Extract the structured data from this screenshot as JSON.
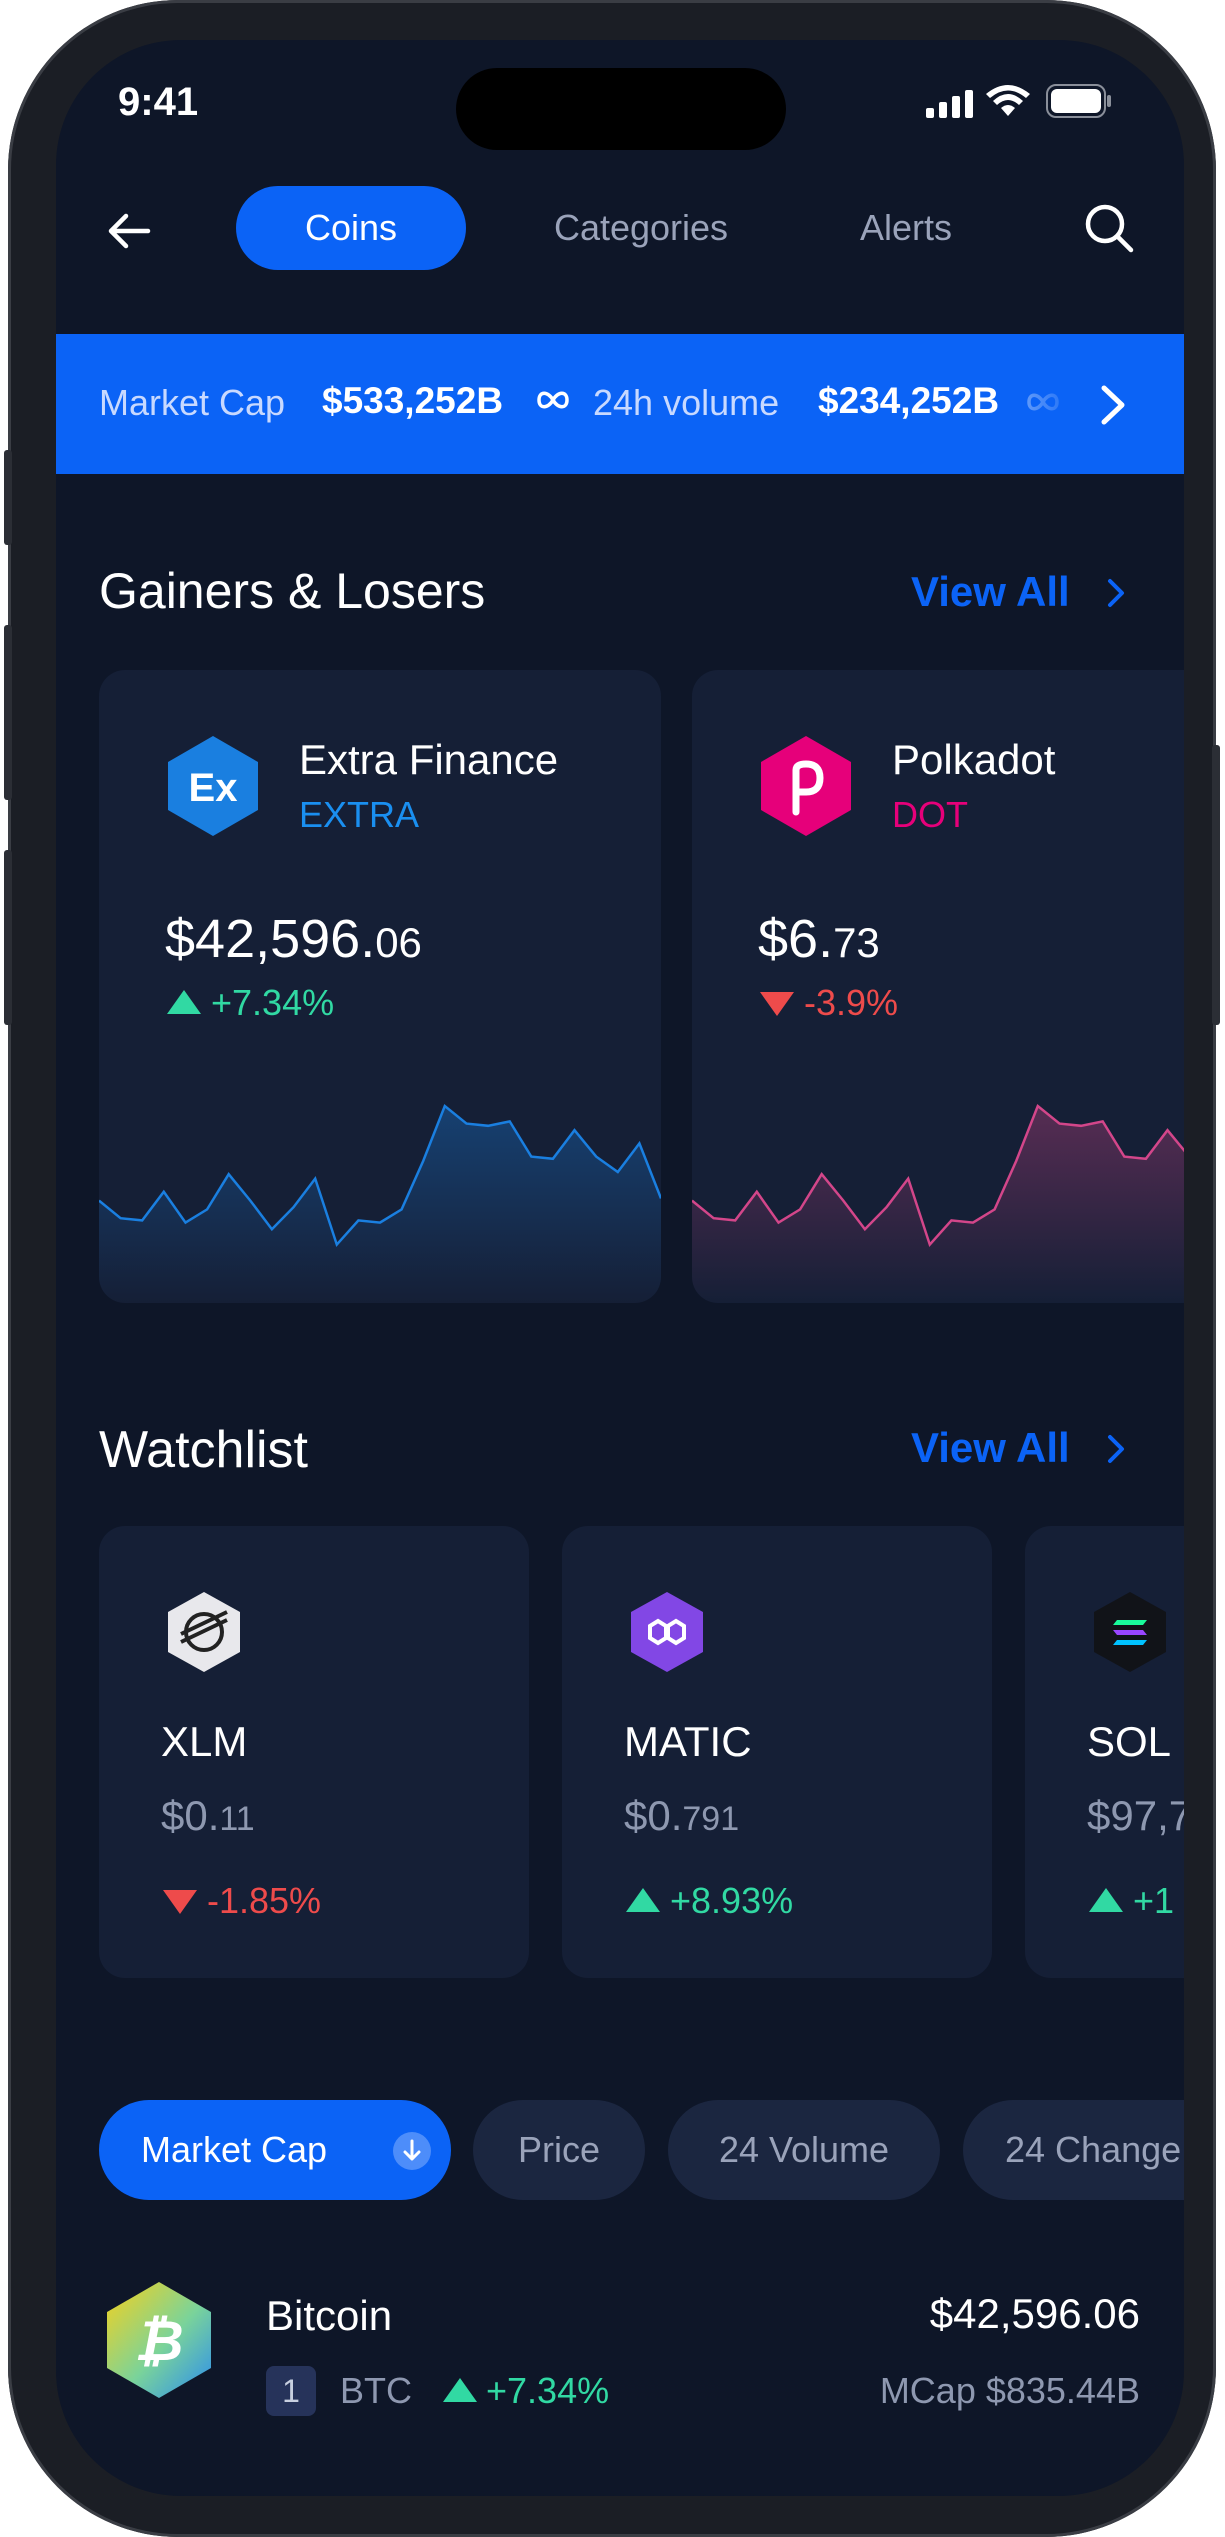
{
  "status": {
    "time": "9:41"
  },
  "nav": {
    "tabs": [
      "Coins",
      "Categories",
      "Alerts"
    ]
  },
  "market": {
    "cap_label": "Market Cap",
    "cap_value": "$533,252B",
    "vol_label": "24h volume",
    "vol_value": "$234,252B"
  },
  "gainers": {
    "title": "Gainers & Losers",
    "view_all": "View All",
    "cards": [
      {
        "name": "Extra Finance",
        "symbol": "EXTRA",
        "price_main": "$42,596.",
        "price_dec": "06",
        "change": "+7.34%",
        "dir": "up",
        "logo_text": "Ex",
        "logo_color": "#1a7fe0",
        "chart_color": "#1a7fe0",
        "spark": [
          42,
          34,
          33,
          46,
          32,
          38,
          54,
          42,
          29,
          39,
          52,
          22,
          33,
          32,
          38,
          60,
          85,
          77,
          76,
          78,
          62,
          61,
          74,
          62,
          55,
          68,
          43
        ]
      },
      {
        "name": "Polkadot",
        "symbol": "DOT",
        "price_main": "$6.",
        "price_dec": "73",
        "change": "-3.9%",
        "dir": "down",
        "logo_text": "P",
        "logo_color": "#e6007a",
        "chart_color": "#d3468a",
        "spark": [
          42,
          34,
          33,
          46,
          32,
          38,
          54,
          42,
          29,
          39,
          52,
          22,
          33,
          32,
          38,
          60,
          85,
          77,
          76,
          78,
          62,
          61,
          74,
          62,
          55,
          68,
          43
        ]
      }
    ]
  },
  "watchlist": {
    "title": "Watchlist",
    "view_all": "View All",
    "items": [
      {
        "symbol": "XLM",
        "price_main": "$0.",
        "price_dec": "11",
        "change": "-1.85%",
        "dir": "down",
        "logo_color": "#e8e8ec",
        "icon": "stellar-icon"
      },
      {
        "symbol": "MATIC",
        "price_main": "$0.",
        "price_dec": "791",
        "change": "+8.93%",
        "dir": "up",
        "logo_color": "#8247e5",
        "icon": "polygon-icon"
      },
      {
        "symbol": "SOL",
        "price_main": "$97,7",
        "price_dec": "",
        "change": "+1",
        "dir": "up",
        "logo_color": "#111318",
        "icon": "solana-icon"
      }
    ]
  },
  "sort": {
    "options": [
      "Market Cap",
      "Price",
      "24 Volume",
      "24 Change"
    ],
    "active": "Market Cap"
  },
  "coins": [
    {
      "name": "Bitcoin",
      "rank": "1",
      "symbol": "BTC",
      "change": "+7.34%",
      "price": "$42,596.06",
      "mcap": "MCap $835.44B"
    }
  ],
  "colors": {
    "accent": "#0b63f6",
    "bg": "#0e1628",
    "card": "#151f36",
    "up": "#31d9a3",
    "down": "#ee4b4b"
  }
}
